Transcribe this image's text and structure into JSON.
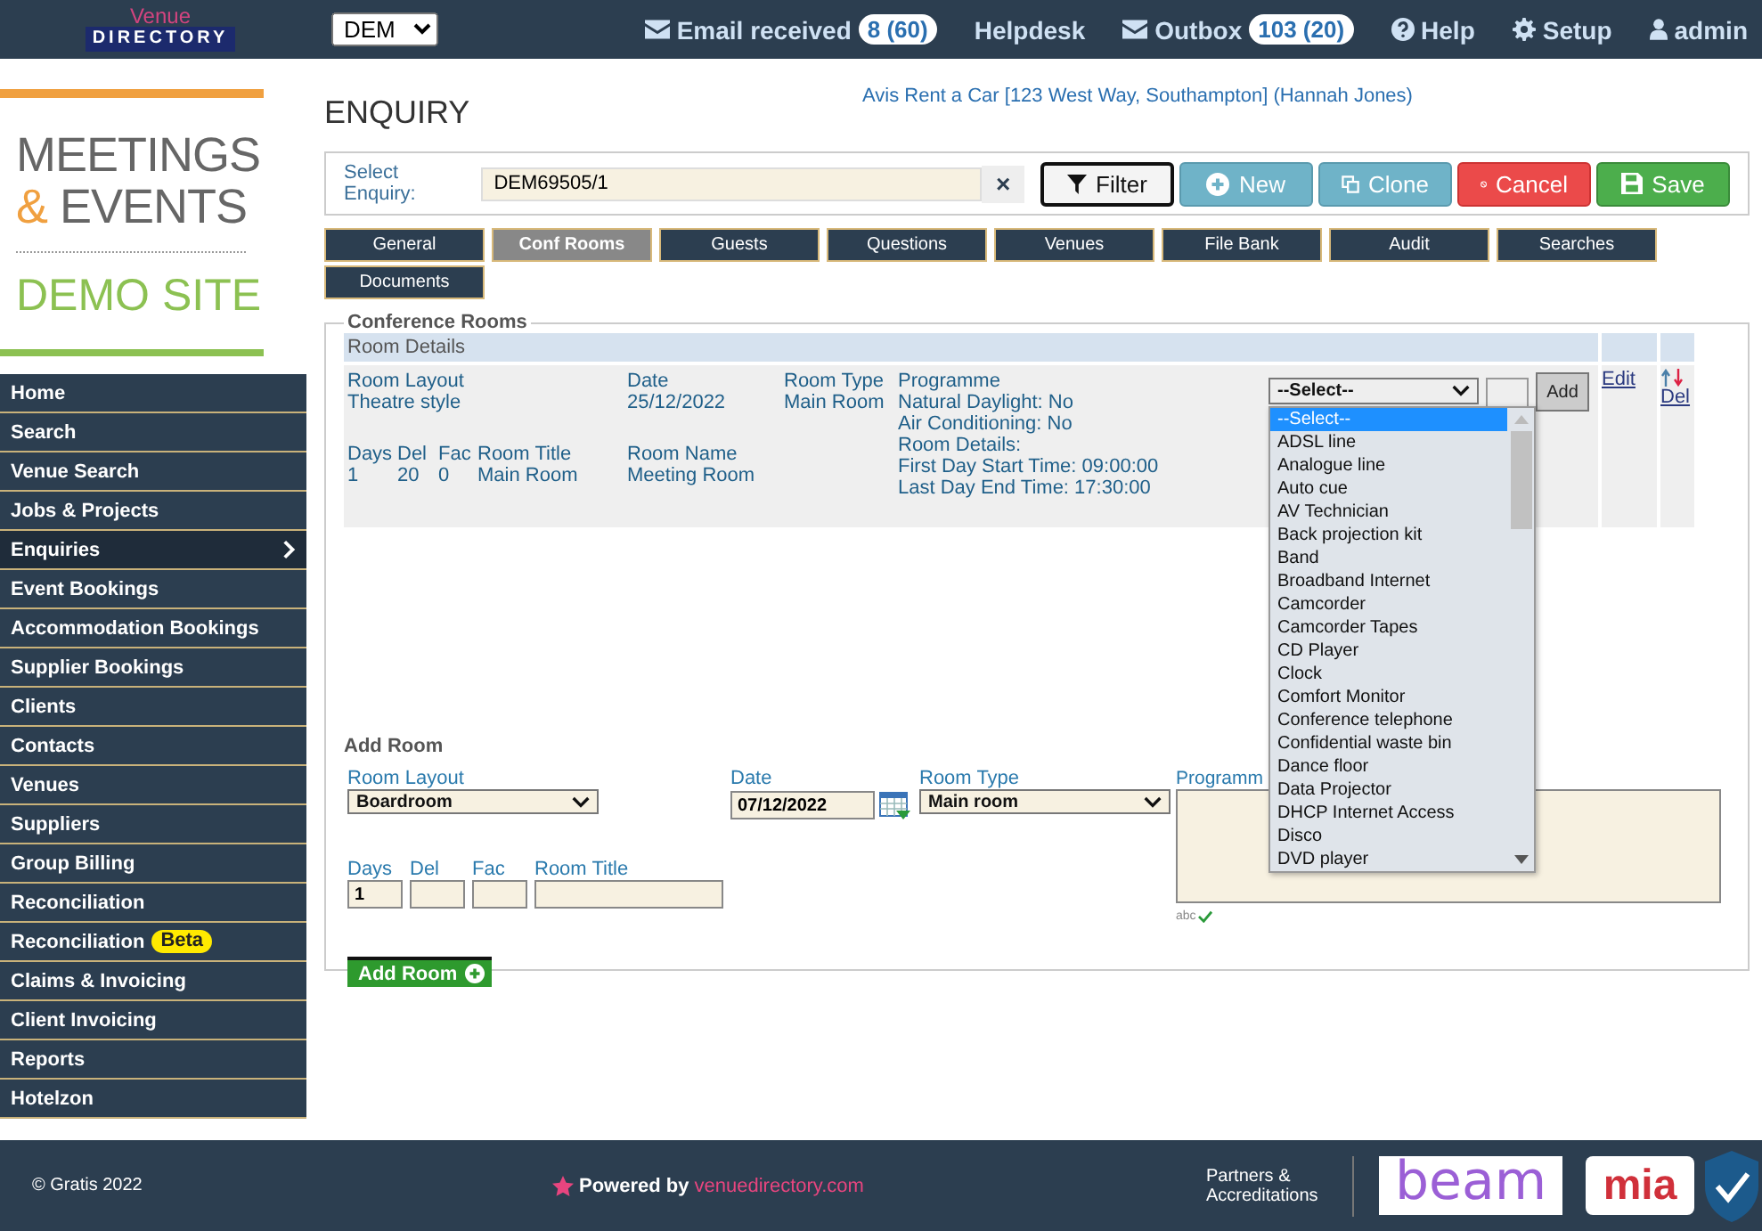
{
  "topbar": {
    "logo_top": "Venue",
    "logo_bottom": "DIRECTORY",
    "site": "DEM",
    "nav": [
      {
        "kind": "mail",
        "label": "Email received",
        "count": "8 (60)"
      },
      {
        "kind": "plain",
        "label": "Helpdesk"
      },
      {
        "kind": "mail",
        "label": "Outbox",
        "count": "103 (20)"
      },
      {
        "kind": "help",
        "label": "Help"
      },
      {
        "kind": "gear",
        "label": "Setup"
      },
      {
        "kind": "user",
        "label": "admin"
      }
    ]
  },
  "brand": {
    "line1": "MEETINGS",
    "amp": "&",
    "line2": "EVENTS",
    "line3": "DEMO SITE"
  },
  "sidebar": {
    "items": [
      {
        "label": "Home",
        "selected": false
      },
      {
        "label": "Search",
        "selected": false
      },
      {
        "label": "Venue Search",
        "selected": false
      },
      {
        "label": "Jobs & Projects",
        "selected": false
      },
      {
        "label": "Enquiries",
        "selected": true
      },
      {
        "label": "Event Bookings",
        "selected": false
      },
      {
        "label": "Accommodation Bookings",
        "selected": false
      },
      {
        "label": "Supplier Bookings",
        "selected": false
      },
      {
        "label": "Clients",
        "selected": false
      },
      {
        "label": "Contacts",
        "selected": false
      },
      {
        "label": "Venues",
        "selected": false
      },
      {
        "label": "Suppliers",
        "selected": false
      },
      {
        "label": "Group Billing",
        "selected": false
      },
      {
        "label": "Reconciliation",
        "selected": false
      },
      {
        "label": "Reconciliation",
        "badge": "Beta",
        "selected": false
      },
      {
        "label": "Claims & Invoicing",
        "selected": false
      },
      {
        "label": "Client Invoicing",
        "selected": false
      },
      {
        "label": "Reports",
        "selected": false
      },
      {
        "label": "Hotelzon",
        "selected": false
      }
    ]
  },
  "page": {
    "title": "ENQUIRY",
    "client": "Avis Rent a Car [123 West Way, Southampton] (Hannah Jones)"
  },
  "enquiry": {
    "label": "Select Enquiry:",
    "value": "DEM69505/1",
    "clear": "×",
    "buttons": [
      {
        "kind": "filter",
        "label": "Filter"
      },
      {
        "kind": "new",
        "label": "New"
      },
      {
        "kind": "clone",
        "label": "Clone"
      },
      {
        "kind": "cancel",
        "label": "Cancel"
      },
      {
        "kind": "save",
        "label": "Save"
      }
    ]
  },
  "tabs": [
    {
      "label": "General",
      "selected": false
    },
    {
      "label": "Conf Rooms",
      "selected": true
    },
    {
      "label": "Guests",
      "selected": false
    },
    {
      "label": "Questions",
      "selected": false
    },
    {
      "label": "Venues",
      "selected": false
    },
    {
      "label": "File Bank",
      "selected": false
    },
    {
      "label": "Audit",
      "selected": false
    },
    {
      "label": "Searches",
      "selected": false
    },
    {
      "label": "Documents",
      "selected": false
    }
  ],
  "conference_rooms": {
    "legend": "Conference Rooms",
    "header": "Room Details",
    "room": {
      "layout_label": "Room Layout",
      "layout": "Theatre style",
      "date_label": "Date",
      "date": "25/12/2022",
      "type_label": "Room Type",
      "type": "Main Room",
      "days_label": "Days",
      "days": "1",
      "del_label": "Del",
      "del": "20",
      "fac_label": "Fac",
      "fac": "0",
      "title_label": "Room Title",
      "title": "Main Room",
      "name_label": "Room Name",
      "name": "Meeting Room",
      "programme_label": "Programme",
      "programme": [
        "Natural Daylight: No",
        "Air Conditioning: No",
        "Room Details:",
        "First Day Start Time: 09:00:00",
        "Last Day End Time: 17:30:00"
      ],
      "equipment_select": "--Select--",
      "add": "Add",
      "edit": "Edit",
      "delete": "Del"
    },
    "equipment_options": [
      {
        "label": "--Select--",
        "selected": true
      },
      {
        "label": "ADSL line",
        "selected": false
      },
      {
        "label": "Analogue line",
        "selected": false
      },
      {
        "label": "Auto cue",
        "selected": false
      },
      {
        "label": "AV Technician",
        "selected": false
      },
      {
        "label": "Back projection kit",
        "selected": false
      },
      {
        "label": "Band",
        "selected": false
      },
      {
        "label": "Broadband Internet",
        "selected": false
      },
      {
        "label": "Camcorder",
        "selected": false
      },
      {
        "label": "Camcorder Tapes",
        "selected": false
      },
      {
        "label": "CD Player",
        "selected": false
      },
      {
        "label": "Clock",
        "selected": false
      },
      {
        "label": "Comfort Monitor",
        "selected": false
      },
      {
        "label": "Conference telephone",
        "selected": false
      },
      {
        "label": "Confidential waste bin",
        "selected": false
      },
      {
        "label": "Dance floor",
        "selected": false
      },
      {
        "label": "Data Projector",
        "selected": false
      },
      {
        "label": "DHCP Internet Access",
        "selected": false
      },
      {
        "label": "Disco",
        "selected": false
      },
      {
        "label": "DVD player",
        "selected": false
      }
    ]
  },
  "add_room": {
    "title": "Add Room",
    "layout_label": "Room Layout",
    "layout": "Boardroom",
    "date_label": "Date",
    "date": "07/12/2022",
    "type_label": "Room Type",
    "type": "Main room",
    "programme_label": "Programm",
    "spellcheck": "abc",
    "days_label": "Days",
    "days": "1",
    "del_label": "Del",
    "fac_label": "Fac",
    "title_label": "Room Title",
    "button": "Add Room"
  },
  "footer": {
    "copyright": "© Gratis 2022",
    "powered": "Powered by",
    "site": "venuedirectory.com",
    "partners": "Partners & Accreditations",
    "partner_logos": [
      "beam",
      "mia"
    ]
  }
}
